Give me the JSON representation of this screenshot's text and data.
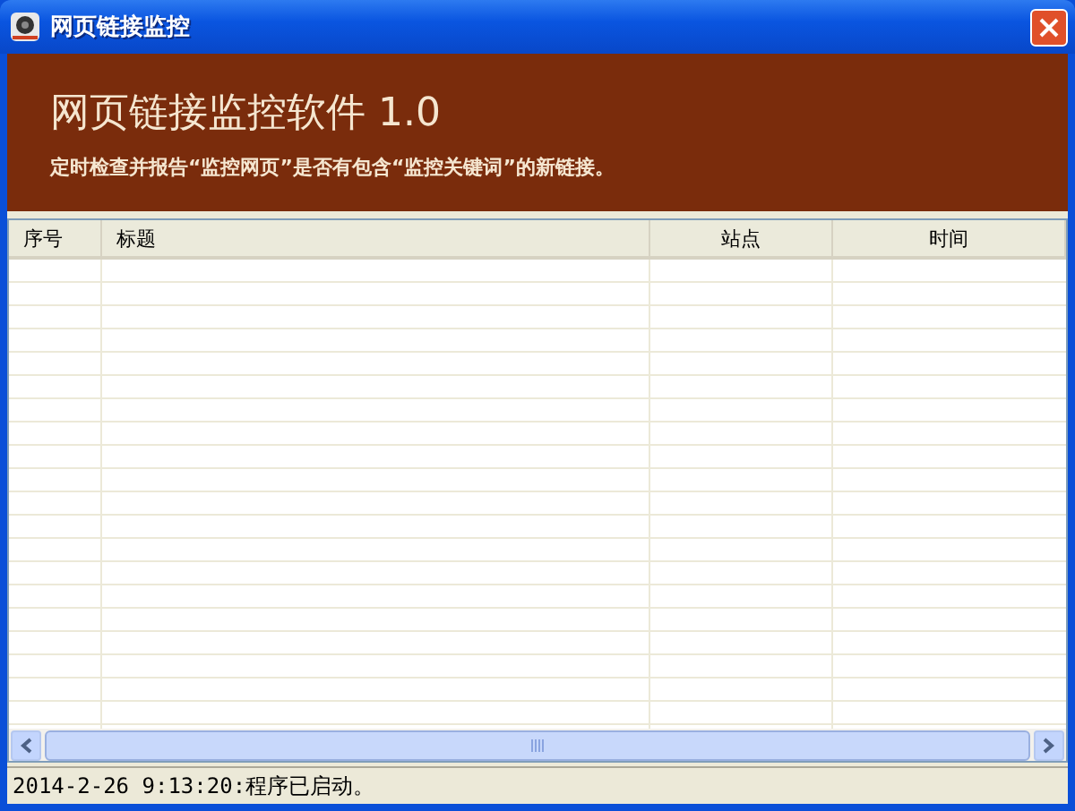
{
  "window": {
    "title": "网页链接监控"
  },
  "banner": {
    "title": "网页链接监控软件 1.0",
    "subtitle": "定时检查并报告“监控网页”是否有包含“监控关键词”的新链接。"
  },
  "table": {
    "columns": [
      "序号",
      "标题",
      "站点",
      "时间"
    ]
  },
  "status_bar": "2014-2-26 9:13:20:程序已启动。"
}
